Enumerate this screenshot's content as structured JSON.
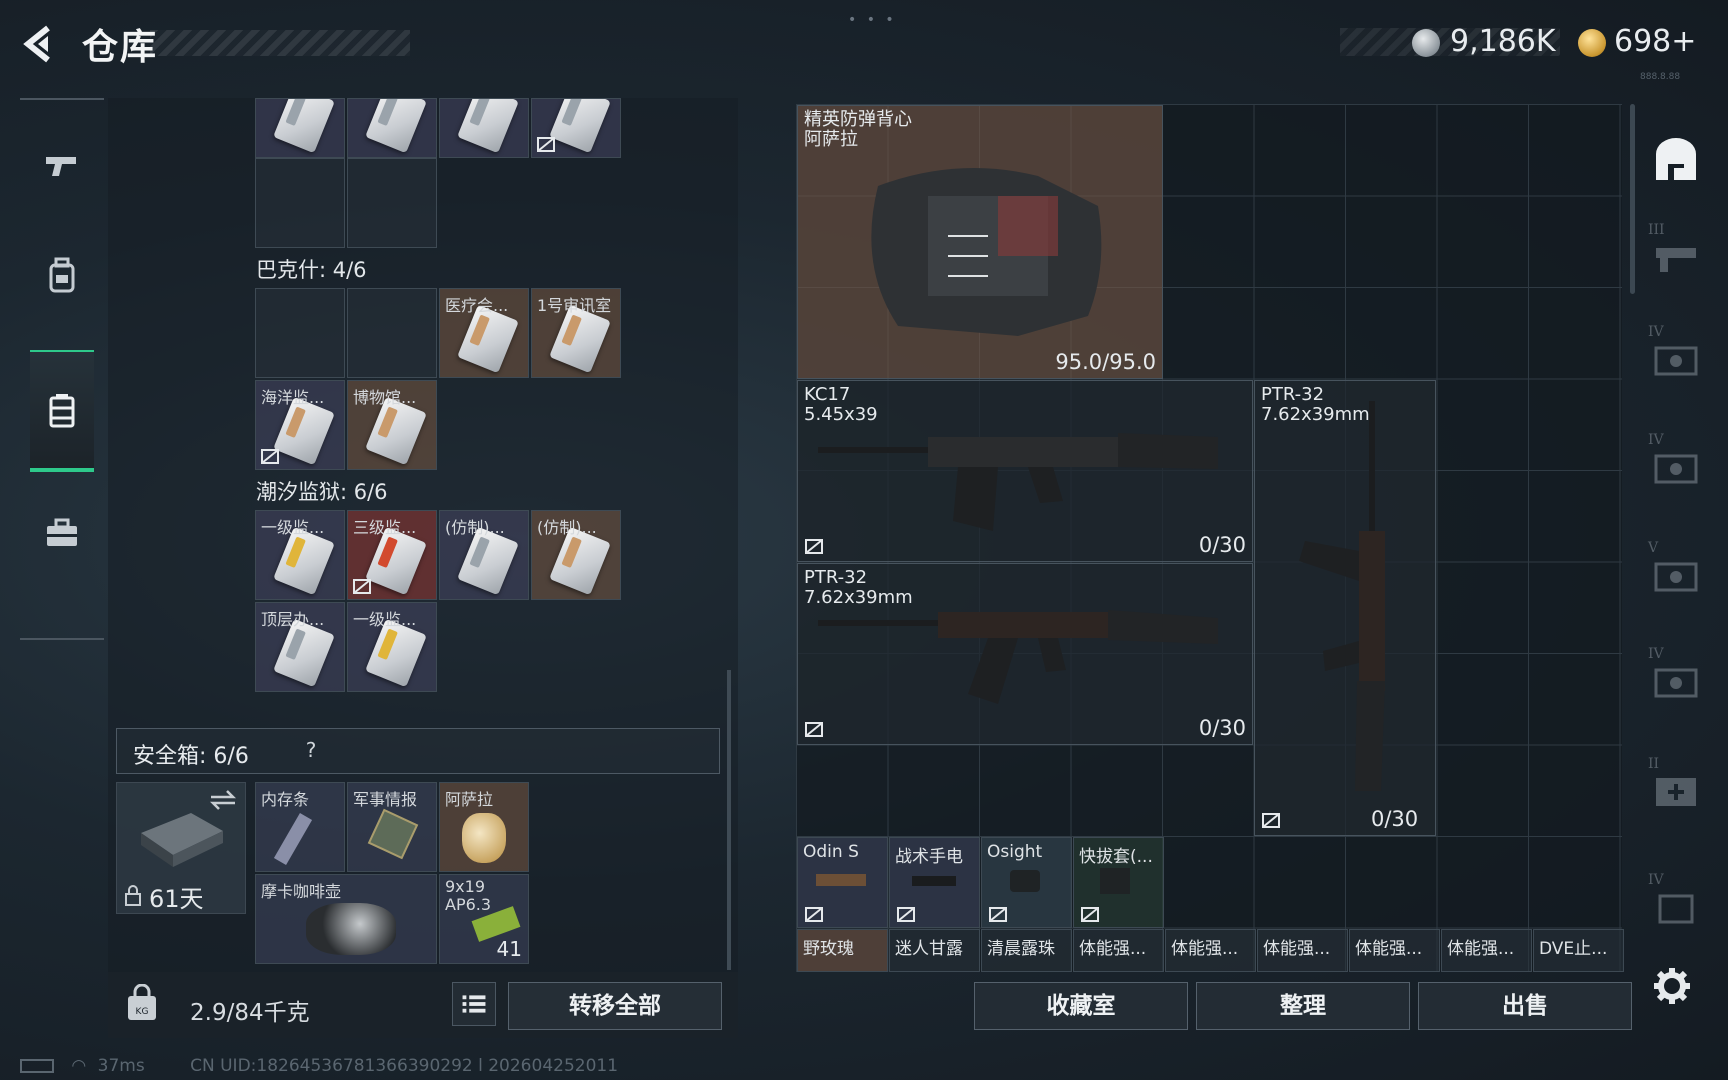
{
  "header": {
    "title": "仓库",
    "silver_amount": "9,186K",
    "gold_amount": "698+",
    "version_text": "888.8.88"
  },
  "left_nav": {
    "items": [
      "weapons",
      "backpack",
      "storage",
      "toolbox"
    ],
    "active": "storage"
  },
  "key_rooms": {
    "top_partial_cells": [
      "",
      "",
      "",
      ""
    ],
    "bakshi": {
      "title": "巴克什: 4/6",
      "cards": [
        "医疗会...",
        "1号审讯室",
        "海洋监...",
        "博物馆..."
      ]
    },
    "tide_prison": {
      "title": "潮汐监狱: 6/6",
      "cards": [
        "一级监...",
        "三级监...",
        "(仿制)...",
        "(仿制)...",
        "顶层办...",
        "一级监..."
      ]
    }
  },
  "safebox": {
    "title": "安全箱: 6/6",
    "help": "?",
    "days": "61天",
    "items": [
      {
        "label": "内存条"
      },
      {
        "label": "军事情报"
      },
      {
        "label": "阿萨拉"
      },
      {
        "label": "摩卡咖啡壶"
      },
      {
        "label": "9x19\nAP6.3",
        "count": "41"
      }
    ]
  },
  "bottom_left": {
    "weight": "2.9/84千克",
    "transfer_label": "转移全部"
  },
  "status_bar": {
    "ping": "37ms",
    "uid": "CN UID:18264536781366390292 l 202604252011"
  },
  "equipment": {
    "vest": {
      "title": "精英防弹背心\n阿萨拉",
      "durability": "95.0/95.0"
    },
    "weapon1": {
      "title": "KC17\n5.45x39",
      "ammo": "0/30"
    },
    "weapon2": {
      "title": "PTR-32\n7.62x39mm",
      "ammo": "0/30"
    },
    "weapon3": {
      "title": "PTR-32\n7.62x39mm",
      "ammo": "0/30"
    },
    "attachments": [
      "Odin S",
      "战术手电",
      "Osight",
      "快拔套(..."
    ],
    "consumables": [
      "野玫瑰",
      "迷人甘露",
      "清晨露珠",
      "体能强...",
      "体能强...",
      "体能强...",
      "体能强...",
      "体能强...",
      "DVE止..."
    ]
  },
  "right_sidebar": {
    "tiers": [
      "III",
      "IV",
      "IV",
      "V",
      "IV",
      "II",
      "IV"
    ]
  },
  "actions": {
    "collection": "收藏室",
    "sort": "整理",
    "sell": "出售"
  },
  "colors": {
    "accent_green": "#2ec98b",
    "brown_cell": "#78584e",
    "red_cell": "#8c3632"
  }
}
